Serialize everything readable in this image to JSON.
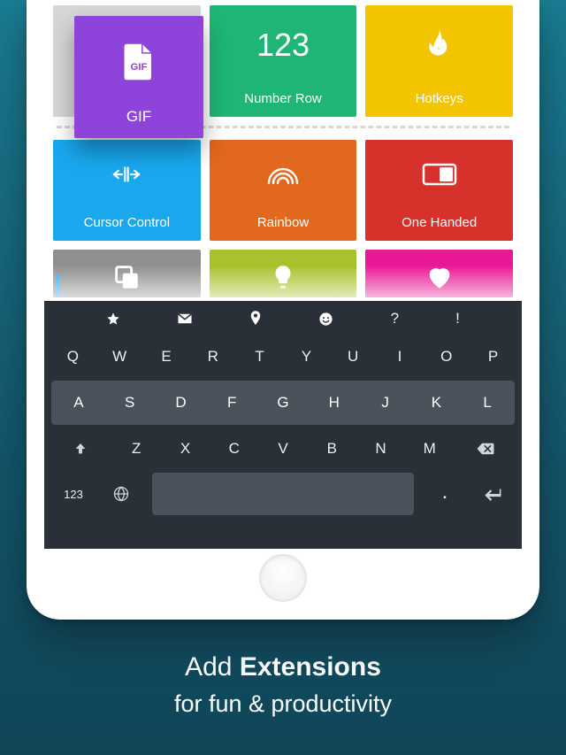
{
  "caption": {
    "line1_pre": "Add ",
    "line1_bold": "Extensions",
    "line2": "for fun & productivity"
  },
  "floating_tile": {
    "label": "GIF",
    "icon": "gif-file-icon",
    "color": "#8e44da"
  },
  "row1": [
    {
      "label": "",
      "icon": "",
      "color": "#d6d6d6",
      "placeholder": true
    },
    {
      "label": "Number Row",
      "big_text": "123",
      "color": "#1fb574"
    },
    {
      "label": "Hotkeys",
      "icon": "flame-icon",
      "color": "#f2c500"
    }
  ],
  "row2": [
    {
      "label": "Cursor Control",
      "icon": "cursor-split-icon",
      "color": "#19a8ee"
    },
    {
      "label": "Rainbow",
      "icon": "rainbow-icon",
      "color": "#e1681c"
    },
    {
      "label": "One Handed",
      "icon": "one-handed-icon",
      "color": "#d6312b"
    }
  ],
  "row3": [
    {
      "icon": "copy-icon",
      "color": "#8f8f8f"
    },
    {
      "icon": "bulb-icon",
      "color": "#a7c22b"
    },
    {
      "icon": "heart-icon",
      "color": "#ea1897"
    }
  ],
  "keyboard": {
    "toprow": [
      {
        "icon": "star-icon"
      },
      {
        "icon": "mail-icon"
      },
      {
        "icon": "pin-icon"
      },
      {
        "icon": "smiley-icon"
      },
      {
        "text": "?"
      },
      {
        "text": "!"
      }
    ],
    "row_q": [
      "Q",
      "W",
      "E",
      "R",
      "T",
      "Y",
      "U",
      "I",
      "O",
      "P"
    ],
    "row_a": [
      "A",
      "S",
      "D",
      "F",
      "G",
      "H",
      "J",
      "K",
      "L"
    ],
    "row_z": {
      "shift_icon": "shift-icon",
      "letters": [
        "Z",
        "X",
        "C",
        "V",
        "B",
        "N",
        "M"
      ],
      "backspace_icon": "backspace-icon"
    },
    "row_bottom": {
      "num_label": "123",
      "globe_icon": "globe-icon",
      "period": ".",
      "enter_icon": "enter-icon"
    }
  }
}
